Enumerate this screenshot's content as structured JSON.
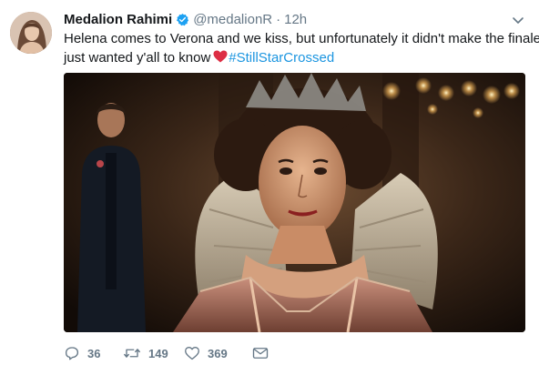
{
  "tweet": {
    "author_name": "Medalion Rahimi",
    "handle": "@medalionR",
    "separator": "·",
    "time": "12h",
    "text_line1": "Helena comes to Verona and we kiss, but unfortunately it didn't make the finale..",
    "text_line2": "just wanted y'all to know",
    "hashtag": "#StillStarCrossed",
    "replies": "36",
    "retweets": "149",
    "likes": "369"
  },
  "icons": {
    "verified": "verified-badge-icon",
    "menu": "chevron-down-icon",
    "emoji": "red-heart-emoji",
    "reply": "reply-icon",
    "retweet": "retweet-icon",
    "like": "heart-outline-icon",
    "dm": "envelope-icon"
  },
  "colors": {
    "text": "#14171a",
    "secondary": "#657786",
    "link": "#1b95e0",
    "verified": "#1da1f2",
    "heart_emoji": "#dd2e44"
  }
}
